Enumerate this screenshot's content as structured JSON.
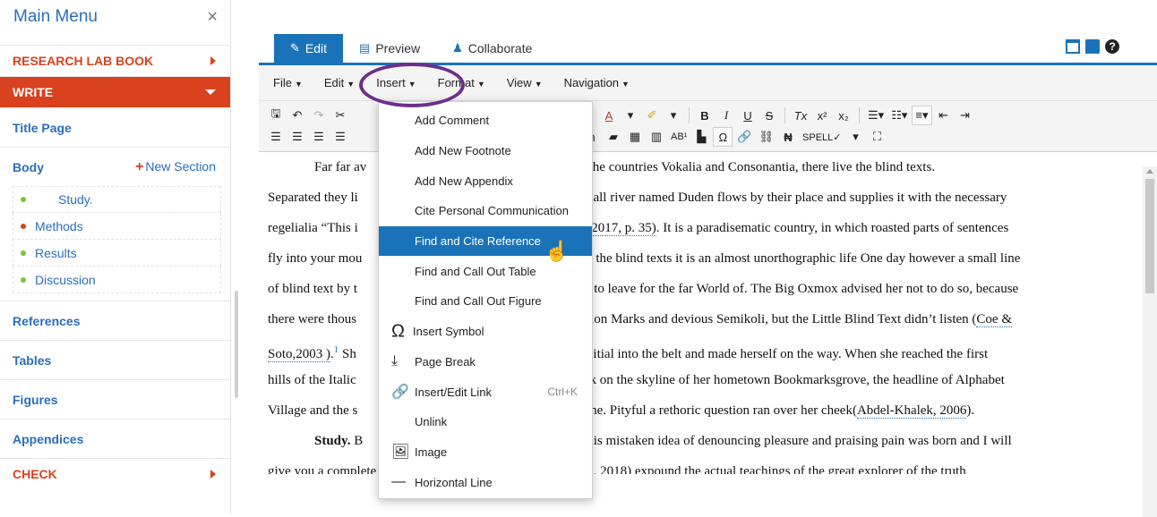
{
  "sidebar": {
    "title": "Main Menu",
    "close": "×",
    "research_lab_book": "RESEARCH LAB BOOK",
    "write": "WRITE",
    "title_page": "Title Page",
    "body": "Body",
    "new_section": "New Section",
    "sections": [
      {
        "label": "Study.",
        "dot": "#7cc142"
      },
      {
        "label": "Methods",
        "dot": "#d9421e"
      },
      {
        "label": "Results",
        "dot": "#7cc142"
      },
      {
        "label": "Discussion",
        "dot": "#7cc142"
      }
    ],
    "references": "References",
    "tables": "Tables",
    "figures": "Figures",
    "appendices": "Appendices",
    "check": "CHECK"
  },
  "tabs": {
    "edit": "Edit",
    "preview": "Preview",
    "collaborate": "Collaborate"
  },
  "menubar": {
    "file": "File",
    "edit": "Edit",
    "insert": "Insert",
    "format": "Format",
    "view": "View",
    "navigation": "Navigation"
  },
  "toolbar": {
    "spell": "SPELL✓"
  },
  "insert_menu": [
    {
      "label": "Add Comment"
    },
    {
      "label": "Add New Footnote"
    },
    {
      "label": "Add New Appendix"
    },
    {
      "label": "Cite Personal Communication"
    },
    {
      "label": "Find and Cite Reference"
    },
    {
      "label": "Find and Call Out Table"
    },
    {
      "label": "Find and Call Out Figure"
    },
    {
      "label": "Insert Symbol"
    },
    {
      "label": "Page Break"
    },
    {
      "label": "Insert/Edit Link",
      "shortcut": "Ctrl+K"
    },
    {
      "label": "Unlink"
    },
    {
      "label": "Image"
    },
    {
      "label": "Horizontal Line"
    }
  ],
  "content": {
    "l1a": "Far far av",
    "l1b": "far from the countries Vokalia and Consonantia, there live the blind texts.",
    "l2a": "Separated they li",
    "l2b": "mall river named Duden flows by their place and supplies it with the necessary",
    "l3a": "regelialia “This i",
    "l3c1": ", 2017, p. 35)",
    "l3b": ". It is a paradisematic country, in which roasted parts of sentences",
    "l4a": "fly into your mou",
    "l4b": "t the blind texts it is an almost unorthographic life One day however a small line",
    "l5a": "of blind text by t",
    "l5b": "d to leave for the far World of. The Big Oxmox advised her not to do so, because",
    "l6a": "there were thous",
    "l6b": "ion Marks and devious Semikoli, but the Little Blind Text didn’t listen (",
    "l6c": "Coe &",
    "l7c": "Soto,2003 )",
    "l7fn": "1",
    "l7a": " Sh",
    "l7b": "her initial into the belt and made herself on the way. When she reached the first",
    "l8a": "hills of the Italic",
    "l8b": "back on the skyline of her hometown Bookmarksgrove, the headline of Alphabet",
    "l9a": "Village and the s",
    "l9b": "Lane. Pityful a rethoric question ran over her cheek(",
    "l9c": "Abdel-Khalek, 2006",
    "l9d": ").",
    "l10bold": "Study.",
    "l10a": " B",
    "l10b": "his mistaken idea of denouncing pleasure and praising pain was born and I will",
    "l11": "give you a complete account of the system, and (Aaron et al., 2018) expound the actual teachings of the great explorer of the truth"
  },
  "colors": {
    "accent": "#1a73b8",
    "brand_orange": "#d9421e",
    "ring": "#6b2f8e"
  }
}
